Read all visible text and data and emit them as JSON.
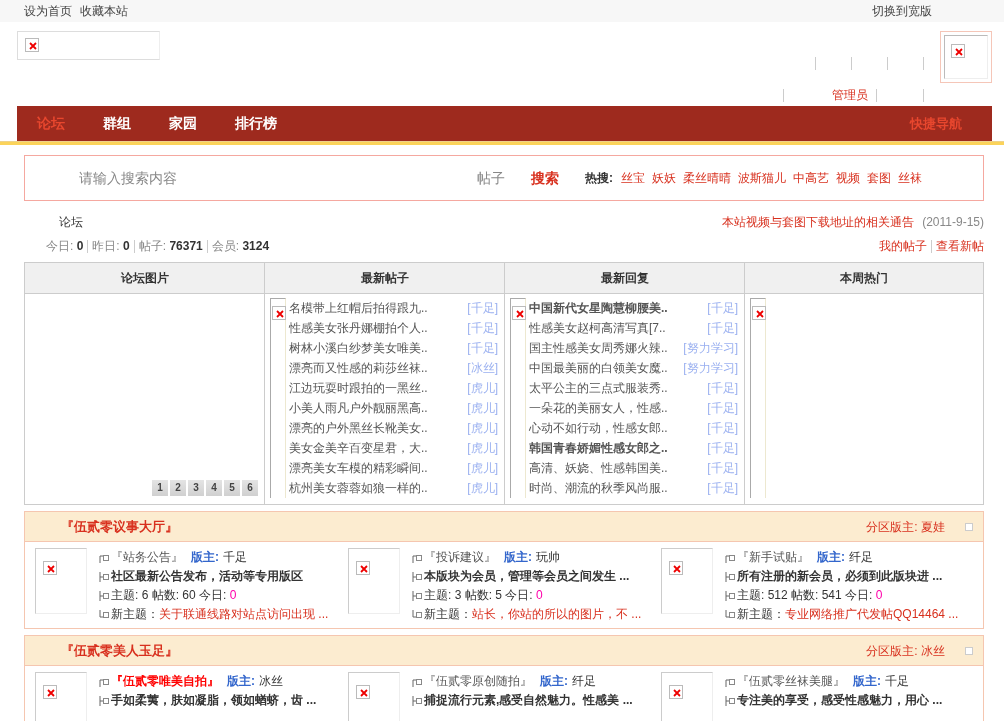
{
  "topbar": {
    "links": [
      "设为首页",
      "收藏本站"
    ],
    "switch": "切换到宽版"
  },
  "header": {
    "user_role": "管理员"
  },
  "nav": {
    "items": [
      {
        "label": "论坛",
        "selected": true
      },
      {
        "label": "群组",
        "selected": false
      },
      {
        "label": "家园",
        "selected": false
      },
      {
        "label": "排行榜",
        "selected": false
      }
    ],
    "quick": "快捷导航"
  },
  "search": {
    "placeholder": "请输入搜索内容",
    "scope": "帖子",
    "button": "搜索",
    "hot_label": "热搜:",
    "hot": [
      "丝宝",
      "妖妖",
      "柔丝晴晴",
      "波斯猫儿",
      "中高艺",
      "视频",
      "套图",
      "丝袜"
    ]
  },
  "breadcrumb": "论坛",
  "notice": {
    "title": "本站视频与套图下载地址的相关通告",
    "date": "(2011-9-15)"
  },
  "stats": [
    {
      "label": "今日:",
      "value": "0"
    },
    {
      "label": "昨日:",
      "value": "0"
    },
    {
      "label": "帖子:",
      "value": "76371"
    },
    {
      "label": "会员:",
      "value": "3124"
    }
  ],
  "user_links": [
    "我的帖子",
    "查看新帖"
  ],
  "panels": {
    "columns": [
      "论坛图片",
      "最新帖子",
      "最新回复",
      "本周热门"
    ],
    "slider_pages": [
      {
        "label": "1",
        "selected": false
      },
      {
        "label": "2",
        "selected": false
      },
      {
        "label": "3",
        "selected": false
      },
      {
        "label": "4",
        "selected": false
      },
      {
        "label": "5",
        "selected": false
      },
      {
        "label": "6",
        "selected": false
      }
    ],
    "latest_posts": [
      {
        "title": "名模带上红帽后拍得跟九..",
        "author": "[千足]",
        "bold": false
      },
      {
        "title": "性感美女张丹娜棚拍个人..",
        "author": "[千足]",
        "bold": false
      },
      {
        "title": "树林小溪白纱梦美女唯美..",
        "author": "[千足]",
        "bold": false
      },
      {
        "title": "漂亮而又性感的莉莎丝袜..",
        "author": "[冰丝]",
        "bold": false
      },
      {
        "title": "江边玩耍时跟拍的一黑丝..",
        "author": "[虎儿]",
        "bold": false
      },
      {
        "title": "小美人雨凡户外靓丽黑高..",
        "author": "[虎儿]",
        "bold": false
      },
      {
        "title": "漂亮的户外黑丝长靴美女..",
        "author": "[虎儿]",
        "bold": false
      },
      {
        "title": "美女金美辛百变星君，大..",
        "author": "[虎儿]",
        "bold": false
      },
      {
        "title": "漂亮美女车模的精彩瞬间..",
        "author": "[虎儿]",
        "bold": false
      },
      {
        "title": "杭州美女蓉蓉如狼一样的..",
        "author": "[虎儿]",
        "bold": false
      }
    ],
    "latest_replies": [
      {
        "title": "中国新代女星陶慧柳腰美..",
        "author": "[千足]",
        "bold": true
      },
      {
        "title": "性感美女赵柯高清写真[7..",
        "author": "[千足]",
        "bold": false
      },
      {
        "title": "国主性感美女周秀娜火辣..",
        "author": "[努力学习]",
        "bold": false
      },
      {
        "title": "中国最美丽的白领美女魔..",
        "author": "[努力学习]",
        "bold": false
      },
      {
        "title": "太平公主的三点式服装秀..",
        "author": "[千足]",
        "bold": false
      },
      {
        "title": "一朵花的美丽女人，性感..",
        "author": "[千足]",
        "bold": false
      },
      {
        "title": "心动不如行动，性感女郎..",
        "author": "[千足]",
        "bold": false
      },
      {
        "title": "韩国青春娇媚性感女郎之..",
        "author": "[千足]",
        "bold": true
      },
      {
        "title": "高清、妖娆、性感韩国美..",
        "author": "[千足]",
        "bold": false
      },
      {
        "title": "时尚、潮流的秋季风尚服..",
        "author": "[千足]",
        "bold": false
      }
    ]
  },
  "sections": [
    {
      "title": "『伍贰零议事大厅』",
      "mod_label": "分区版主:",
      "mod": "夏娃",
      "forums": [
        {
          "name": "『站务公告』",
          "highlight": false,
          "mod_label": "版主:",
          "mod": "千足",
          "desc": "社区最新公告发布，活动等专用版区",
          "stats": "主题: 6 帖数: 60 今日:",
          "today": "0",
          "new_label": "新主题：",
          "new": "关于联通线路对站点访问出现 ..."
        },
        {
          "name": "『投诉建议』",
          "highlight": false,
          "mod_label": "版主:",
          "mod": "玩帅",
          "desc": "本版块为会员，管理等会员之间发生 ...",
          "stats": "主题: 3 帖数: 5 今日:",
          "today": "0",
          "new_label": "新主题：",
          "new": "站长，你站的所以的图片，不 ..."
        },
        {
          "name": "『新手试贴』",
          "highlight": false,
          "mod_label": "版主:",
          "mod": "纤足",
          "desc": "所有注册的新会员，必须到此版块进 ...",
          "stats": "主题: 512 帖数: 541 今日:",
          "today": "0",
          "new_label": "新主题：",
          "new": "专业网络推广代发帖QQ14464 ..."
        }
      ]
    },
    {
      "title": "『伍贰零美人玉足』",
      "mod_label": "分区版主:",
      "mod": "冰丝",
      "forums": [
        {
          "name": "『伍贰零唯美自拍』",
          "highlight": true,
          "mod_label": "版主:",
          "mod": "冰丝",
          "desc": "手如柔荑，肤如凝脂，领如蝤蛴，齿 ..."
        },
        {
          "name": "『伍贰零原创随拍』",
          "highlight": false,
          "mod_label": "版主:",
          "mod": "纤足",
          "desc": "捕捉流行元素,感受自然魅力。性感美 ..."
        },
        {
          "name": "『伍贰零丝袜美腿』",
          "highlight": false,
          "mod_label": "版主:",
          "mod": "千足",
          "desc": "专注美的享受，感受性感魅力，用心 ..."
        }
      ]
    }
  ]
}
